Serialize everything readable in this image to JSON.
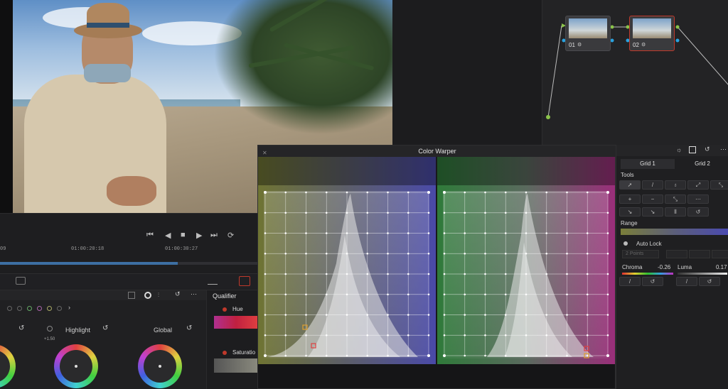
{
  "transport": {
    "buttons": [
      "⏮",
      "◀",
      "■",
      "▶",
      "⏭",
      "⟳"
    ],
    "timecodes": [
      "09",
      "01:00:20:18",
      "01:00:30:27"
    ]
  },
  "wheels": {
    "highlight_label": "Highlight",
    "global_label": "Global",
    "highlight_value": "+1.50"
  },
  "qualifier": {
    "title": "Qualifier",
    "hue_label": "Hue",
    "saturation_label": "Saturatio"
  },
  "nodes": [
    {
      "label": "01"
    },
    {
      "label": "02"
    }
  ],
  "color_warper": {
    "title": "Color Warper"
  },
  "right_panel": {
    "tabs": [
      "Grid 1",
      "Grid 2"
    ],
    "tools_label": "Tools",
    "range_label": "Range",
    "auto_lock_label": "Auto Lock",
    "points_select": "2 Points",
    "chroma_label": "Chroma",
    "chroma_value": "-0.26",
    "luma_label": "Luma",
    "luma_value": "0.17"
  },
  "colors": {
    "accent_red": "#c0392b",
    "timeline_blue": "#3d6fa3",
    "node_link_green": "#8bc34a",
    "node_link_blue": "#29a3e0"
  }
}
